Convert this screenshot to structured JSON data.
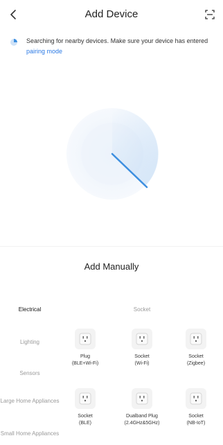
{
  "header": {
    "title": "Add Device"
  },
  "notice": {
    "text": "Searching for nearby devices. Make sure your device has entered ",
    "link": "pairing mode"
  },
  "add_manually": {
    "title": "Add Manually"
  },
  "categories": [
    {
      "label": "Electrical"
    },
    {
      "label": "Lighting"
    },
    {
      "label": "Sensors"
    },
    {
      "label": "Large Home Appliances"
    },
    {
      "label": "Small Home Appliances"
    }
  ],
  "section": {
    "title": "Socket"
  },
  "devices": [
    {
      "line1": "Plug",
      "line2": "(BLE+Wi-Fi)"
    },
    {
      "line1": "Socket",
      "line2": "(Wi-Fi)"
    },
    {
      "line1": "Socket",
      "line2": "(Zigbee)"
    },
    {
      "line1": "Socket",
      "line2": "(BLE)"
    },
    {
      "line1": "Dualband Plug",
      "line2": "(2.4GHz&5GHz)"
    },
    {
      "line1": "Socket",
      "line2": "(NB-IoT)"
    }
  ],
  "colors": {
    "accent": "#2d7be5",
    "radar_sweep": "#3d8fe0",
    "radar_bg": "#eef4fb"
  },
  "icons": {
    "back": "chevron-left-icon",
    "scan": "scan-icon",
    "status": "spinner-icon",
    "device": "socket-icon"
  }
}
